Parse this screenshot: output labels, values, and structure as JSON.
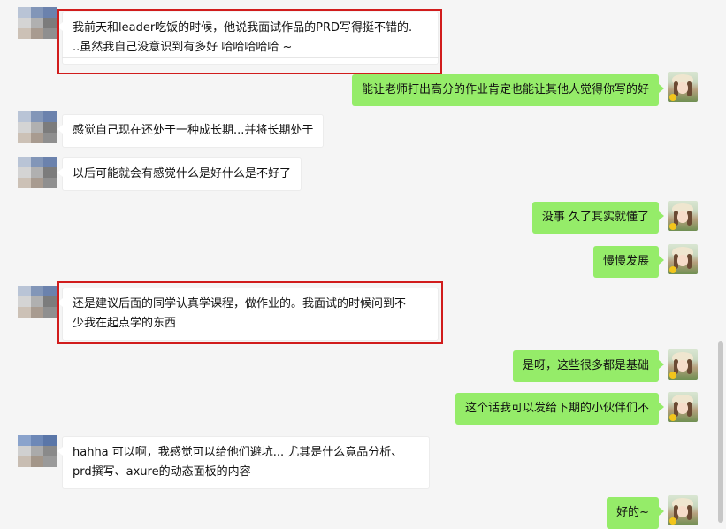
{
  "messages": [
    {
      "side": "left",
      "lines": [
        "我前天和leader吃饭的时候，他说我面试作品的PRD写得挺不错的.",
        "..虽然我自己没意识到有多好 哈哈哈哈哈 ~"
      ]
    },
    {
      "side": "right",
      "text": "能让老师打出高分的作业肯定也能让其他人觉得你写的好"
    },
    {
      "side": "left",
      "text": "感觉自己现在还处于一种成长期...并将长期处于"
    },
    {
      "side": "left",
      "text": "以后可能就会有感觉什么是好什么是不好了"
    },
    {
      "side": "right",
      "text": "没事  久了其实就懂了"
    },
    {
      "side": "right",
      "text": "慢慢发展"
    },
    {
      "side": "left",
      "lines": [
        "还是建议后面的同学认真学课程，做作业的。我面试的时候问到不",
        "少我在起点学的东西"
      ]
    },
    {
      "side": "right",
      "text": "是呀，这些很多都是基础"
    },
    {
      "side": "right",
      "text": "这个话我可以发给下期的小伙伴们不"
    },
    {
      "side": "left",
      "lines": [
        "hahha 可以啊，我感觉可以给他们避坑... 尤其是什么竟品分析、",
        "prd撰写、axure的动态面板的内容"
      ]
    },
    {
      "side": "right",
      "text": "好的~"
    }
  ],
  "colors": {
    "background": "#f5f5f5",
    "bubble_self": "#95ec69",
    "bubble_other": "#ffffff",
    "highlight_box": "#d11c1c"
  },
  "icons": {
    "left_avatar": "pixelated-avatar-icon",
    "right_avatar": "girl-with-hat-avatar-icon"
  }
}
